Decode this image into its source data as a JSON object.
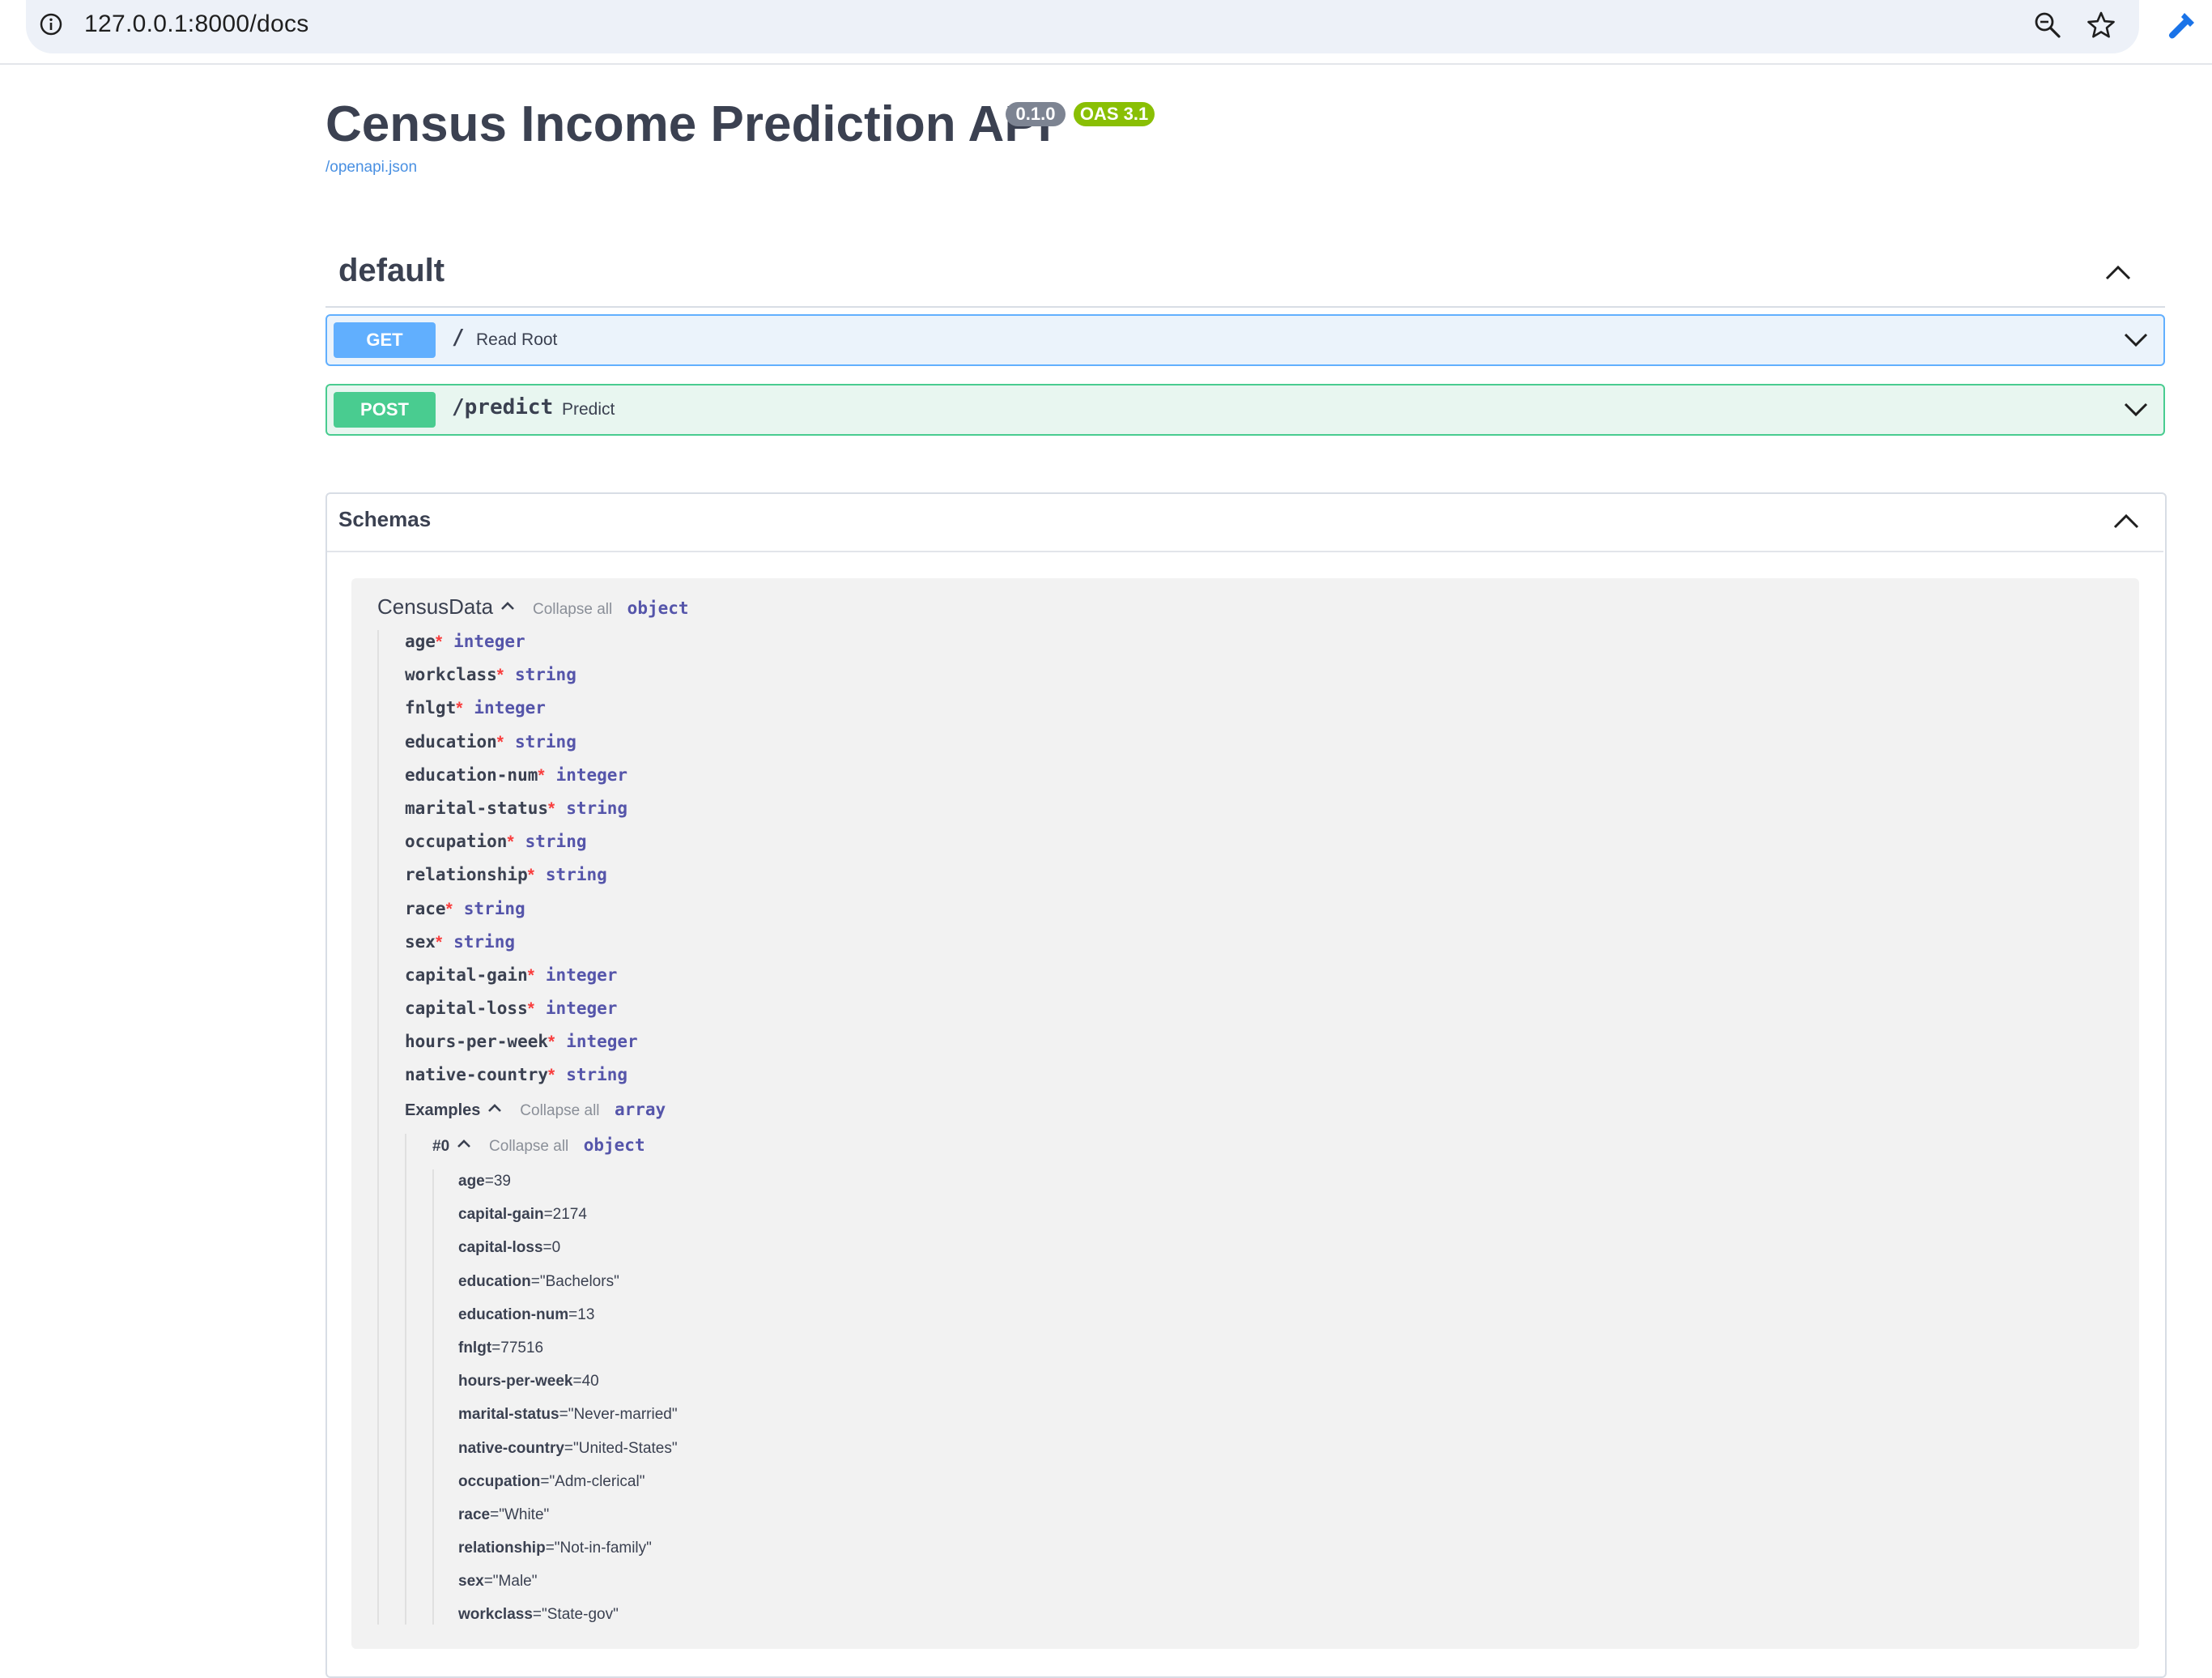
{
  "browser": {
    "url": "127.0.0.1:8000/docs"
  },
  "header": {
    "title": "Census Income Prediction API",
    "version_badge": "0.1.0",
    "oas_badge": "OAS 3.1",
    "spec_link": "/openapi.json"
  },
  "tag": {
    "name": "default"
  },
  "operations": [
    {
      "method": "GET",
      "path": "/",
      "summary": "Read Root"
    },
    {
      "method": "POST",
      "path": "/predict",
      "summary": "Predict"
    }
  ],
  "schemas": {
    "title": "Schemas",
    "model": {
      "name": "CensusData",
      "collapse_label": "Collapse all",
      "type": "object",
      "properties": [
        {
          "name": "age",
          "required": "*",
          "type": "integer"
        },
        {
          "name": "workclass",
          "required": "*",
          "type": "string"
        },
        {
          "name": "fnlgt",
          "required": "*",
          "type": "integer"
        },
        {
          "name": "education",
          "required": "*",
          "type": "string"
        },
        {
          "name": "education-num",
          "required": "*",
          "type": "integer"
        },
        {
          "name": "marital-status",
          "required": "*",
          "type": "string"
        },
        {
          "name": "occupation",
          "required": "*",
          "type": "string"
        },
        {
          "name": "relationship",
          "required": "*",
          "type": "string"
        },
        {
          "name": "race",
          "required": "*",
          "type": "string"
        },
        {
          "name": "sex",
          "required": "*",
          "type": "string"
        },
        {
          "name": "capital-gain",
          "required": "*",
          "type": "integer"
        },
        {
          "name": "capital-loss",
          "required": "*",
          "type": "integer"
        },
        {
          "name": "hours-per-week",
          "required": "*",
          "type": "integer"
        },
        {
          "name": "native-country",
          "required": "*",
          "type": "string"
        }
      ],
      "examples": {
        "label": "Examples",
        "collapse_label": "Collapse all",
        "type": "array",
        "item": {
          "label": "#0",
          "collapse_label": "Collapse all",
          "type": "object",
          "values": [
            {
              "key": "age",
              "value": "=39"
            },
            {
              "key": "capital-gain",
              "value": "=2174"
            },
            {
              "key": "capital-loss",
              "value": "=0"
            },
            {
              "key": "education",
              "value": "=\"Bachelors\""
            },
            {
              "key": "education-num",
              "value": "=13"
            },
            {
              "key": "fnlgt",
              "value": "=77516"
            },
            {
              "key": "hours-per-week",
              "value": "=40"
            },
            {
              "key": "marital-status",
              "value": "=\"Never-married\""
            },
            {
              "key": "native-country",
              "value": "=\"United-States\""
            },
            {
              "key": "occupation",
              "value": "=\"Adm-clerical\""
            },
            {
              "key": "race",
              "value": "=\"White\""
            },
            {
              "key": "relationship",
              "value": "=\"Not-in-family\""
            },
            {
              "key": "sex",
              "value": "=\"Male\""
            },
            {
              "key": "workclass",
              "value": "=\"State-gov\""
            }
          ]
        }
      }
    }
  },
  "colors": {
    "get": "#61affe",
    "post": "#49cc90",
    "version_badge": "#7d8492",
    "oas_badge": "#89bf04",
    "required": "#f93e3e",
    "type_keyword": "#5555aa"
  }
}
